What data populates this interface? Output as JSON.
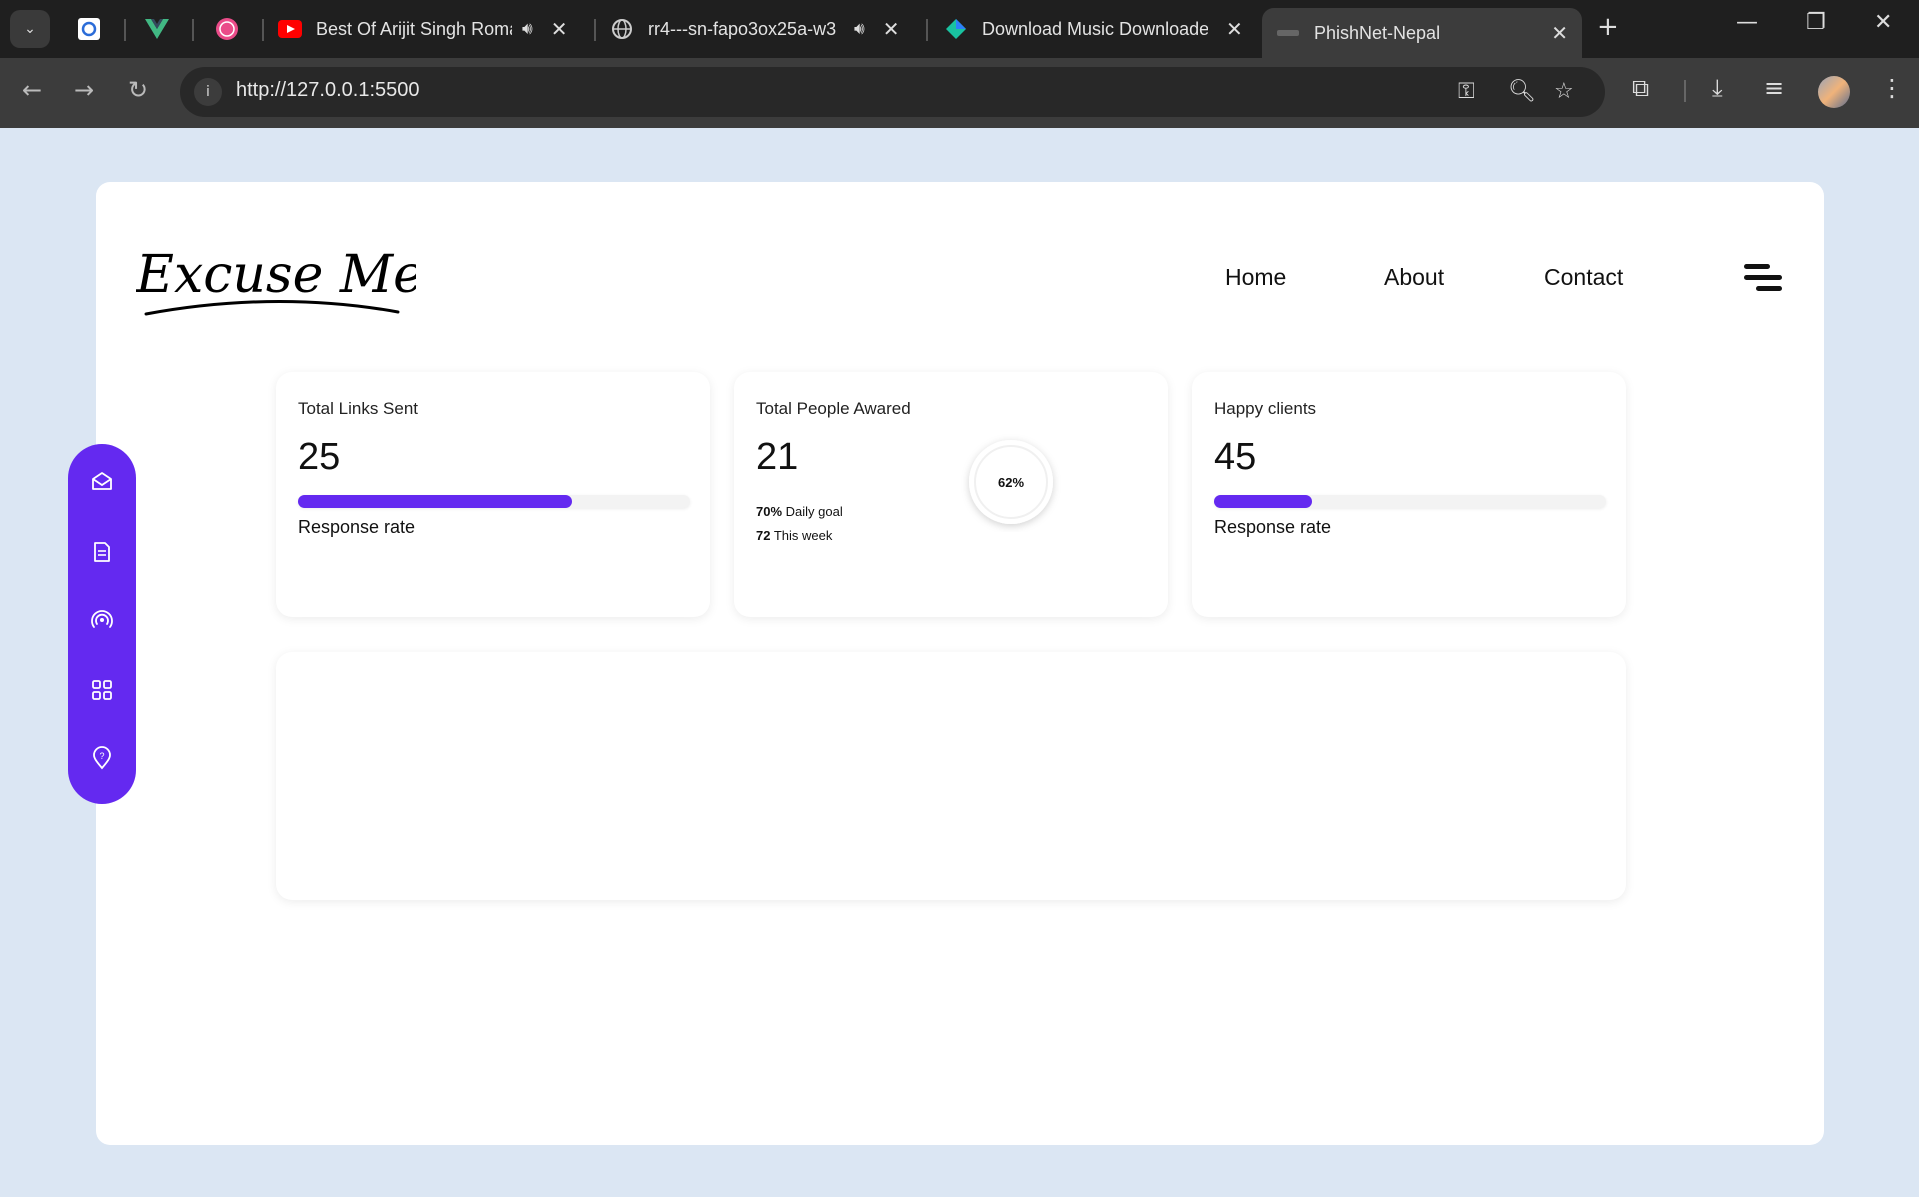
{
  "browser": {
    "tabs": [
      {
        "title": "Best Of Arijit Singh Romantic",
        "audio": true
      },
      {
        "title": "rr4---sn-fapo3ox25a-w3",
        "audio": true
      },
      {
        "title": "Download Music Downloader",
        "audio": false
      },
      {
        "title": "PhishNet-Nepal",
        "audio": false,
        "active": true
      }
    ],
    "url": "http://127.0.0.1:5500"
  },
  "header": {
    "logo_text": "Excuse Me!",
    "nav": [
      "Home",
      "About",
      "Contact"
    ]
  },
  "stats": [
    {
      "label": "Total Links Sent",
      "value": "25",
      "progress": 0.7,
      "caption": "Response rate"
    },
    {
      "label": "Total People Awared",
      "value": "21",
      "ring_percent": "62%",
      "daily_goal_value": "70%",
      "daily_goal_label": "Daily goal",
      "week_value": "72",
      "week_label": "This week"
    },
    {
      "label": "Happy clients",
      "value": "45",
      "progress": 0.25,
      "caption": "Response rate"
    }
  ],
  "sidebar": {
    "icons": [
      "mail-icon",
      "document-icon",
      "broadcast-icon",
      "grid-icon",
      "location-icon"
    ]
  },
  "colors": {
    "accent": "#6429f0",
    "background": "#dbe6f3"
  }
}
